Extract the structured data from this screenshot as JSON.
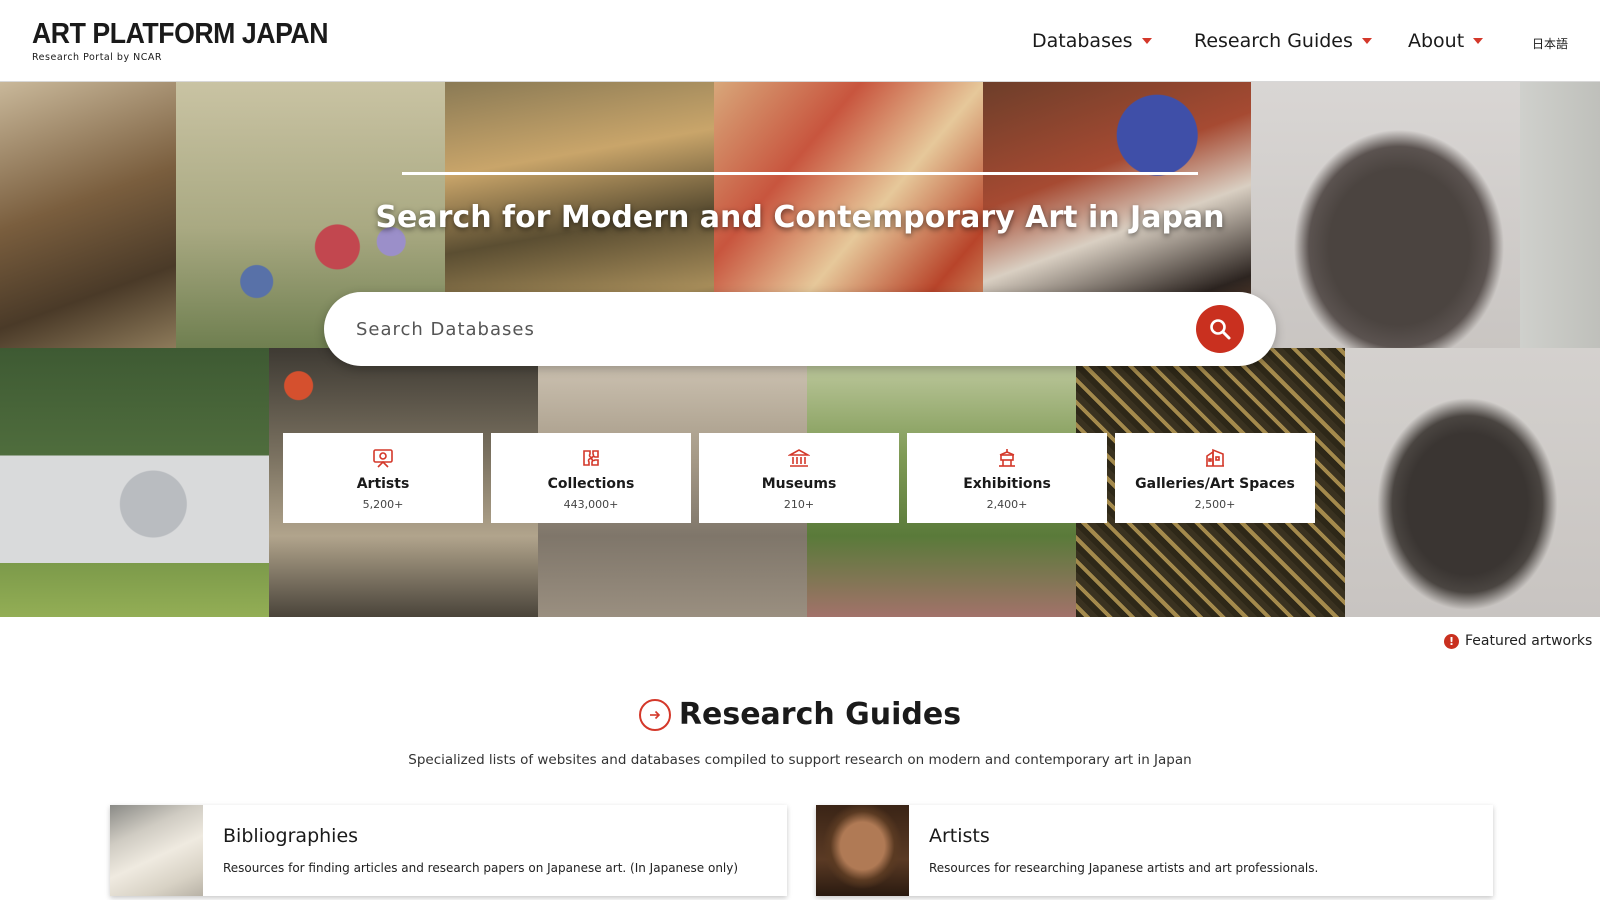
{
  "header": {
    "logo_title": "ART PLATFORM JAPAN",
    "logo_subtitle": "Research Portal by NCAR",
    "nav": [
      {
        "label": "Databases"
      },
      {
        "label": "Research Guides"
      },
      {
        "label": "About"
      }
    ],
    "lang": "日本語"
  },
  "hero": {
    "title": "Search for Modern and Contemporary Art in Japan",
    "search_placeholder": "Search Databases",
    "search_icon": "search-icon"
  },
  "categories": [
    {
      "label": "Artists",
      "count": "5,200+",
      "icon": "artist-icon"
    },
    {
      "label": "Collections",
      "count": "443,000+",
      "icon": "collections-icon"
    },
    {
      "label": "Museums",
      "count": "210+",
      "icon": "museum-icon"
    },
    {
      "label": "Exhibitions",
      "count": "2,400+",
      "icon": "exhibition-icon"
    },
    {
      "label": "Galleries/Art Spaces",
      "count": "2,500+",
      "icon": "gallery-icon"
    }
  ],
  "featured": {
    "label": "Featured artworks",
    "icon_glyph": "!"
  },
  "research_guides": {
    "title": "Research Guides",
    "subtitle": "Specialized lists of websites and databases compiled to support research on modern and contemporary art in Japan",
    "items": [
      {
        "title": "Bibliographies",
        "desc": "Resources for finding articles and research papers on Japanese art. (In Japanese only)"
      },
      {
        "title": "Artists",
        "desc": "Resources for researching Japanese artists and art professionals."
      }
    ]
  },
  "colors": {
    "accent": "#c9301f",
    "text": "#1a1a1a"
  }
}
